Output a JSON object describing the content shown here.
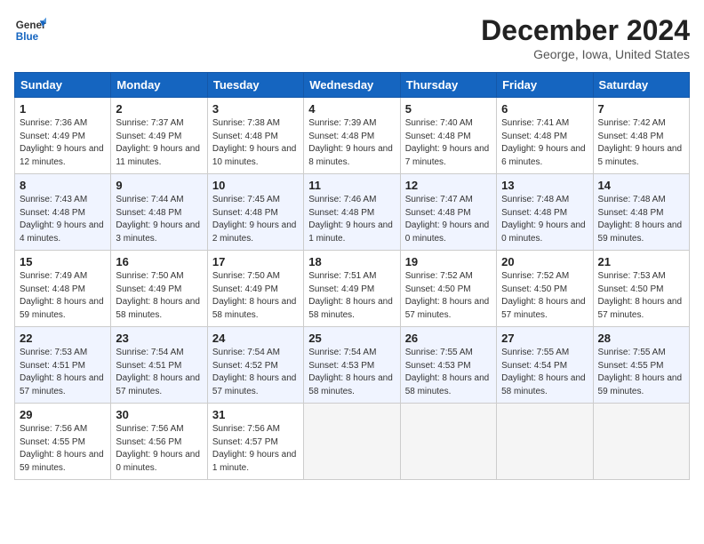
{
  "header": {
    "logo_general": "General",
    "logo_blue": "Blue",
    "title": "December 2024",
    "subtitle": "George, Iowa, United States"
  },
  "weekdays": [
    "Sunday",
    "Monday",
    "Tuesday",
    "Wednesday",
    "Thursday",
    "Friday",
    "Saturday"
  ],
  "weeks": [
    [
      {
        "day": "1",
        "sunrise": "7:36 AM",
        "sunset": "4:49 PM",
        "daylight": "9 hours and 12 minutes."
      },
      {
        "day": "2",
        "sunrise": "7:37 AM",
        "sunset": "4:49 PM",
        "daylight": "9 hours and 11 minutes."
      },
      {
        "day": "3",
        "sunrise": "7:38 AM",
        "sunset": "4:48 PM",
        "daylight": "9 hours and 10 minutes."
      },
      {
        "day": "4",
        "sunrise": "7:39 AM",
        "sunset": "4:48 PM",
        "daylight": "9 hours and 8 minutes."
      },
      {
        "day": "5",
        "sunrise": "7:40 AM",
        "sunset": "4:48 PM",
        "daylight": "9 hours and 7 minutes."
      },
      {
        "day": "6",
        "sunrise": "7:41 AM",
        "sunset": "4:48 PM",
        "daylight": "9 hours and 6 minutes."
      },
      {
        "day": "7",
        "sunrise": "7:42 AM",
        "sunset": "4:48 PM",
        "daylight": "9 hours and 5 minutes."
      }
    ],
    [
      {
        "day": "8",
        "sunrise": "7:43 AM",
        "sunset": "4:48 PM",
        "daylight": "9 hours and 4 minutes."
      },
      {
        "day": "9",
        "sunrise": "7:44 AM",
        "sunset": "4:48 PM",
        "daylight": "9 hours and 3 minutes."
      },
      {
        "day": "10",
        "sunrise": "7:45 AM",
        "sunset": "4:48 PM",
        "daylight": "9 hours and 2 minutes."
      },
      {
        "day": "11",
        "sunrise": "7:46 AM",
        "sunset": "4:48 PM",
        "daylight": "9 hours and 1 minute."
      },
      {
        "day": "12",
        "sunrise": "7:47 AM",
        "sunset": "4:48 PM",
        "daylight": "9 hours and 0 minutes."
      },
      {
        "day": "13",
        "sunrise": "7:48 AM",
        "sunset": "4:48 PM",
        "daylight": "9 hours and 0 minutes."
      },
      {
        "day": "14",
        "sunrise": "7:48 AM",
        "sunset": "4:48 PM",
        "daylight": "8 hours and 59 minutes."
      }
    ],
    [
      {
        "day": "15",
        "sunrise": "7:49 AM",
        "sunset": "4:48 PM",
        "daylight": "8 hours and 59 minutes."
      },
      {
        "day": "16",
        "sunrise": "7:50 AM",
        "sunset": "4:49 PM",
        "daylight": "8 hours and 58 minutes."
      },
      {
        "day": "17",
        "sunrise": "7:50 AM",
        "sunset": "4:49 PM",
        "daylight": "8 hours and 58 minutes."
      },
      {
        "day": "18",
        "sunrise": "7:51 AM",
        "sunset": "4:49 PM",
        "daylight": "8 hours and 58 minutes."
      },
      {
        "day": "19",
        "sunrise": "7:52 AM",
        "sunset": "4:50 PM",
        "daylight": "8 hours and 57 minutes."
      },
      {
        "day": "20",
        "sunrise": "7:52 AM",
        "sunset": "4:50 PM",
        "daylight": "8 hours and 57 minutes."
      },
      {
        "day": "21",
        "sunrise": "7:53 AM",
        "sunset": "4:50 PM",
        "daylight": "8 hours and 57 minutes."
      }
    ],
    [
      {
        "day": "22",
        "sunrise": "7:53 AM",
        "sunset": "4:51 PM",
        "daylight": "8 hours and 57 minutes."
      },
      {
        "day": "23",
        "sunrise": "7:54 AM",
        "sunset": "4:51 PM",
        "daylight": "8 hours and 57 minutes."
      },
      {
        "day": "24",
        "sunrise": "7:54 AM",
        "sunset": "4:52 PM",
        "daylight": "8 hours and 57 minutes."
      },
      {
        "day": "25",
        "sunrise": "7:54 AM",
        "sunset": "4:53 PM",
        "daylight": "8 hours and 58 minutes."
      },
      {
        "day": "26",
        "sunrise": "7:55 AM",
        "sunset": "4:53 PM",
        "daylight": "8 hours and 58 minutes."
      },
      {
        "day": "27",
        "sunrise": "7:55 AM",
        "sunset": "4:54 PM",
        "daylight": "8 hours and 58 minutes."
      },
      {
        "day": "28",
        "sunrise": "7:55 AM",
        "sunset": "4:55 PM",
        "daylight": "8 hours and 59 minutes."
      }
    ],
    [
      {
        "day": "29",
        "sunrise": "7:56 AM",
        "sunset": "4:55 PM",
        "daylight": "8 hours and 59 minutes."
      },
      {
        "day": "30",
        "sunrise": "7:56 AM",
        "sunset": "4:56 PM",
        "daylight": "9 hours and 0 minutes."
      },
      {
        "day": "31",
        "sunrise": "7:56 AM",
        "sunset": "4:57 PM",
        "daylight": "9 hours and 1 minute."
      },
      null,
      null,
      null,
      null
    ]
  ],
  "labels": {
    "sunrise": "Sunrise:",
    "sunset": "Sunset:",
    "daylight": "Daylight:"
  }
}
